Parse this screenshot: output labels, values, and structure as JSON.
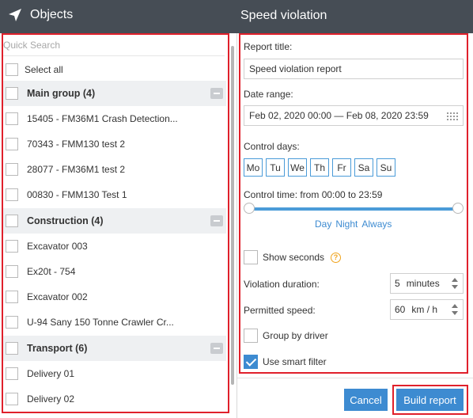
{
  "header": {
    "left_title": "Objects",
    "right_title": "Speed violation"
  },
  "objects": {
    "search_placeholder": "Quick Search",
    "select_all": "Select all",
    "groups": [
      {
        "name": "Main group (4)",
        "items": [
          "15405 - FM36M1 Crash Detection...",
          "70343 - FMM130 test 2",
          "28077 - FM36M1 test 2",
          "00830 - FMM130 Test 1"
        ]
      },
      {
        "name": "Construction (4)",
        "items": [
          "Excavator 003",
          "Ex20t - 754",
          "Excavator 002",
          "U-94 Sany 150 Tonne Crawler Cr..."
        ]
      },
      {
        "name": "Transport (6)",
        "items": [
          "Delivery 01",
          "Delivery 02"
        ]
      }
    ]
  },
  "report": {
    "title_label": "Report title:",
    "title_value": "Speed violation report",
    "date_label": "Date range:",
    "date_value": "Feb 02, 2020 00:00 — Feb 08, 2020 23:59",
    "control_days_label": "Control days:",
    "days": [
      "Mo",
      "Tu",
      "We",
      "Th",
      "Fr",
      "Sa",
      "Su"
    ],
    "control_time_label": "Control time: from 00:00 to 23:59",
    "presets": [
      "Day",
      "Night",
      "Always"
    ],
    "show_seconds": "Show seconds",
    "duration_label": "Violation duration:",
    "duration_value": "5",
    "duration_unit": "minutes",
    "speed_label": "Permitted speed:",
    "speed_value": "60",
    "speed_unit": "km / h",
    "group_by_driver": "Group by driver",
    "smart_filter": "Use smart filter",
    "smart_filter_checked": true
  },
  "buttons": {
    "cancel": "Cancel",
    "build": "Build report"
  },
  "colors": {
    "header_bg": "#464d55",
    "accent": "#3d8bd1",
    "highlight": "#e0202b"
  }
}
